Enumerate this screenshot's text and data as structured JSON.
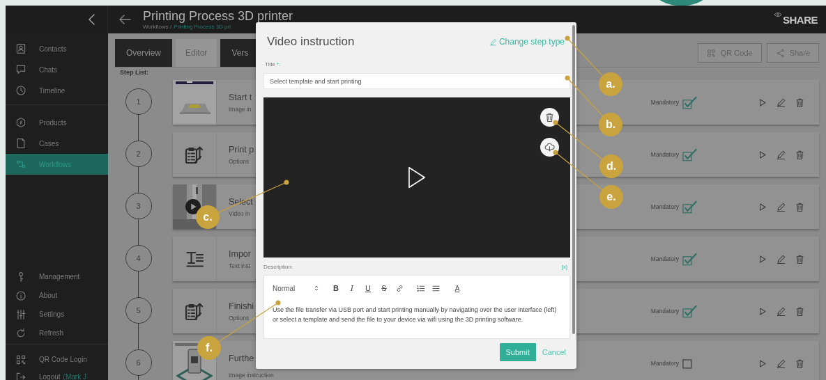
{
  "header": {
    "title": "Printing Process 3D printer",
    "breadcrumb_root": "Workflows /",
    "breadcrumb_current": "Printing Process 3D pri",
    "brand": "SHARE"
  },
  "sidebar": {
    "sections": [
      {
        "items": [
          {
            "label": "Contacts",
            "selected": false
          },
          {
            "label": "Chats",
            "selected": false
          },
          {
            "label": "Timeline",
            "selected": false
          }
        ]
      },
      {
        "items": [
          {
            "label": "Products",
            "selected": false
          },
          {
            "label": "Cases",
            "selected": false
          },
          {
            "label": "Workflows",
            "selected": true
          }
        ]
      },
      {
        "items": [
          {
            "label": "Management",
            "selected": false
          },
          {
            "label": "About",
            "selected": false
          },
          {
            "label": "Settings",
            "selected": false
          },
          {
            "label": "Refresh",
            "selected": false
          }
        ]
      },
      {
        "items": [
          {
            "label": "QR Code Login",
            "selected": false
          },
          {
            "label": "Logout",
            "user": "(Mark J",
            "selected": false
          }
        ]
      }
    ]
  },
  "tabs": [
    {
      "label": "Overview",
      "selected": false
    },
    {
      "label": "Editor",
      "selected": true
    },
    {
      "label": "Vers",
      "selected": false
    }
  ],
  "toolbar_buttons": [
    {
      "label": "QR Code",
      "kind": "qr"
    },
    {
      "label": "Share",
      "kind": "share"
    }
  ],
  "step_list_label": "Step List:",
  "steps": [
    {
      "number": "1",
      "title": "Start t",
      "subtitle": "Image in",
      "mandatory_label": "Mandatory",
      "mandatory": true
    },
    {
      "number": "2",
      "title": "Print p",
      "subtitle": "Options",
      "kind": "options",
      "mandatory_label": "Mandatory",
      "mandatory": true
    },
    {
      "number": "3",
      "title": "Select",
      "subtitle": "Video in",
      "kind": "video",
      "mandatory_label": "Mandatory",
      "mandatory": true
    },
    {
      "number": "4",
      "title": "Impor",
      "subtitle": "Text inst",
      "kind": "text",
      "mandatory_label": "Mandatory",
      "mandatory": true
    },
    {
      "number": "5",
      "title": "Finishi",
      "subtitle": "Options",
      "kind": "options",
      "mandatory_label": "Mandatory",
      "mandatory": true
    },
    {
      "number": "6",
      "title": "Furthe",
      "subtitle": "Image instruction",
      "kind": "poster",
      "mandatory_label": "Mandatory",
      "mandatory": false
    }
  ],
  "dialog": {
    "title": "Video instruction",
    "change_type": "Change step type",
    "title_label": "Title",
    "required_mark": "*:",
    "title_value": "Select template and start printing",
    "description_label": "Description:",
    "variables": "[x]",
    "editor": {
      "format": "Normal",
      "tools": [
        {
          "kind": "bold",
          "label": "B"
        },
        {
          "kind": "italic",
          "label": "I"
        },
        {
          "kind": "underline",
          "label": "U"
        },
        {
          "kind": "strike",
          "label": "S"
        },
        {
          "kind": "link"
        },
        {
          "kind": "ordered-list"
        },
        {
          "kind": "bullet-list"
        },
        {
          "kind": "color",
          "label": "A"
        }
      ],
      "text": "Use the file transfer via USB port and start printing manually by navigating over the user interface (left) or select a template and send the file to your device via wifi using the 3D printing software."
    },
    "submit": "Submit",
    "cancel": "Cancel"
  },
  "callouts": [
    {
      "label": "a."
    },
    {
      "label": "b."
    },
    {
      "label": "c."
    },
    {
      "label": "d."
    },
    {
      "label": "e."
    },
    {
      "label": "f."
    }
  ]
}
